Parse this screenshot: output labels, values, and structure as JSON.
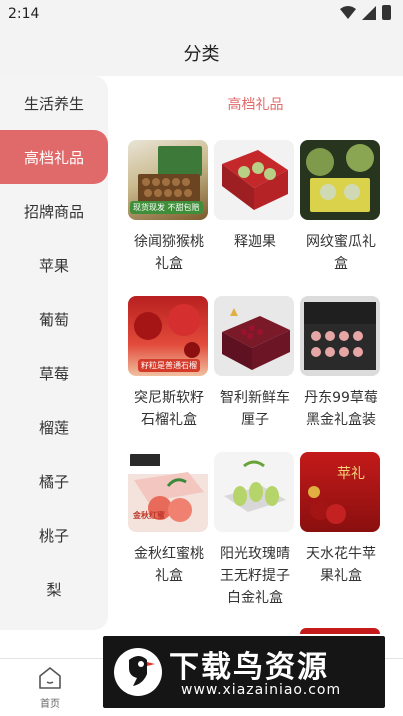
{
  "status": {
    "time": "2:14"
  },
  "header": {
    "title": "分类"
  },
  "sidebar": {
    "items": [
      {
        "label": "生活养生"
      },
      {
        "label": "高档礼品"
      },
      {
        "label": "招牌商品"
      },
      {
        "label": "苹果"
      },
      {
        "label": "葡萄"
      },
      {
        "label": "草莓"
      },
      {
        "label": "榴莲"
      },
      {
        "label": "橘子"
      },
      {
        "label": "桃子"
      },
      {
        "label": "梨"
      }
    ],
    "active_index": 1
  },
  "main": {
    "section_title": "高档礼品",
    "products": [
      {
        "name": "徐闻猕猴桃礼盒",
        "thumb_text": "现货现发 不甜包赔"
      },
      {
        "name": "释迦果"
      },
      {
        "name": "网纹蜜瓜礼盒"
      },
      {
        "name": "突尼斯软籽石榴礼盒",
        "thumb_text": "籽粒是普通石榴"
      },
      {
        "name": "智利新鲜车厘子"
      },
      {
        "name": "丹东99草莓黑金礼盒装"
      },
      {
        "name": "金秋红蜜桃礼盒",
        "thumb_text": "金秋红蜜"
      },
      {
        "name": "阳光玫瑰晴王无籽提子白金礼盒"
      },
      {
        "name": "天水花牛苹果礼盒",
        "thumb_text": "苹礼"
      }
    ]
  },
  "bottom_nav": {
    "items": [
      {
        "label": "首页",
        "icon": "home-icon"
      }
    ]
  },
  "watermark": {
    "title": "下载鸟资源",
    "url": "www.xiazainiao.com"
  },
  "colors": {
    "accent": "#e06a6a",
    "sidebar_bg": "#f4f4f4",
    "header_bg": "#f3f3f3"
  }
}
